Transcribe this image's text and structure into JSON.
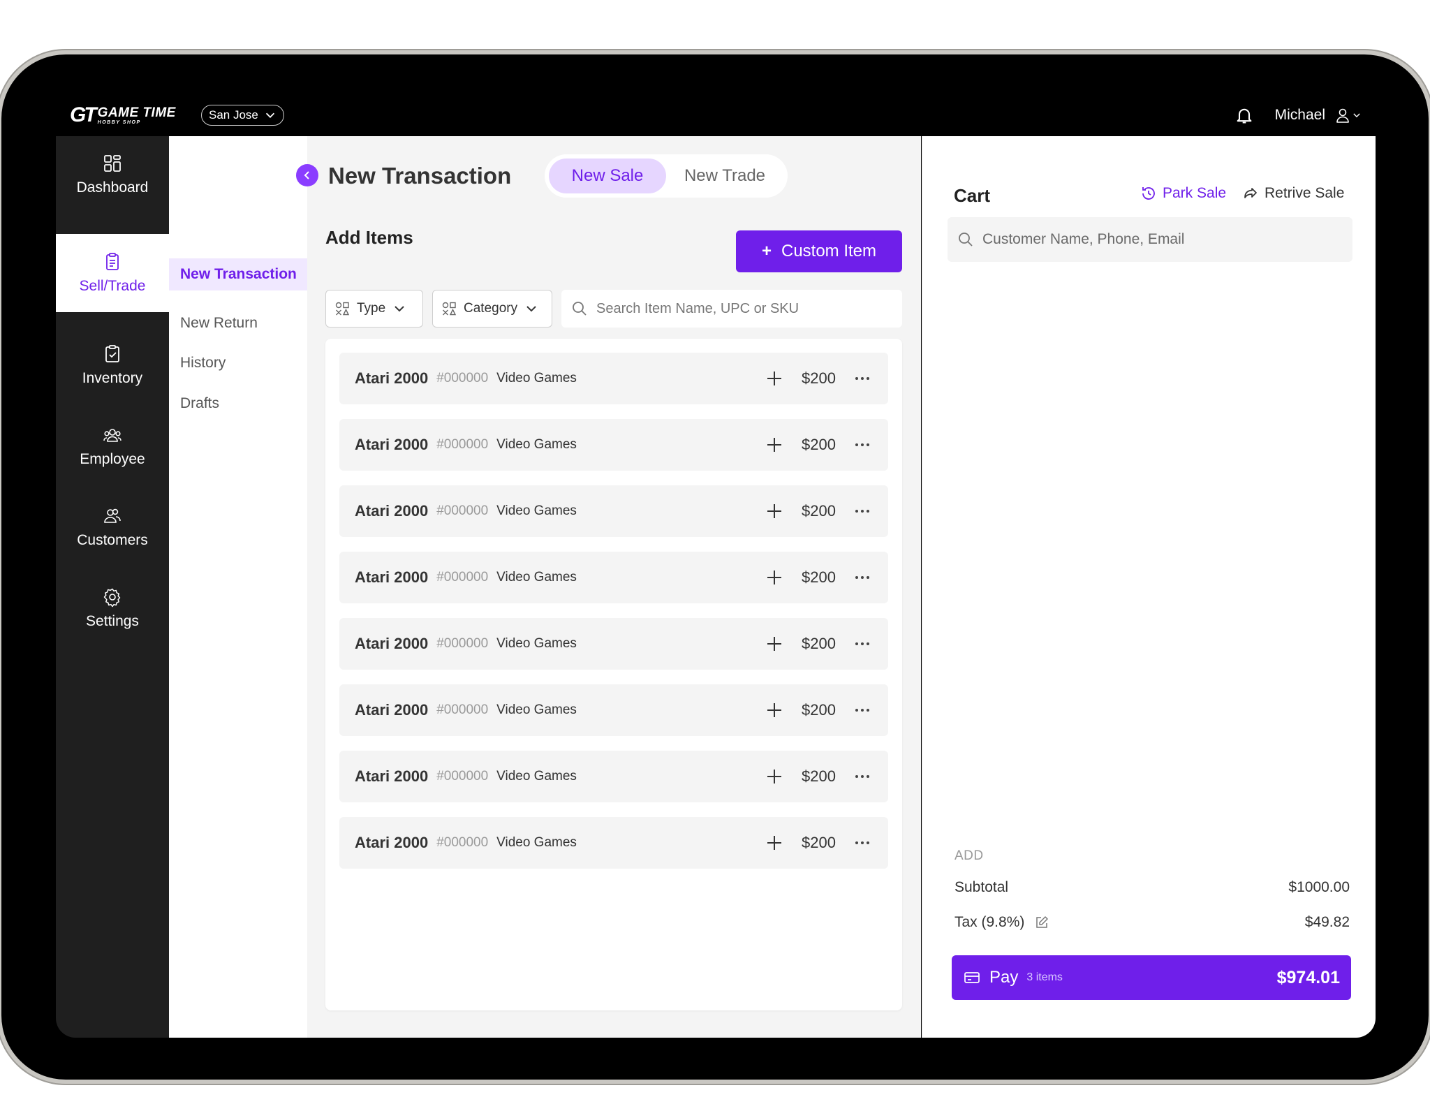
{
  "brand": {
    "mark": "GT",
    "name": "GAME TIME",
    "tagline": "HOBBY SHOP"
  },
  "location": {
    "selected": "San Jose"
  },
  "user": {
    "name": "Michael"
  },
  "nav": {
    "items": [
      {
        "label": "Dashboard",
        "icon": "grid-icon"
      },
      {
        "label": "Sell/Trade",
        "icon": "clipboard-icon",
        "active": true
      },
      {
        "label": "Inventory",
        "icon": "clipboard-check-icon"
      },
      {
        "label": "Employee",
        "icon": "group-icon"
      },
      {
        "label": "Customers",
        "icon": "users-icon"
      },
      {
        "label": "Settings",
        "icon": "gear-icon"
      }
    ]
  },
  "subnav": {
    "items": [
      {
        "label": "New Transaction",
        "active": true
      },
      {
        "label": "New Return"
      },
      {
        "label": "History"
      },
      {
        "label": "Drafts"
      }
    ]
  },
  "main": {
    "title": "New Transaction",
    "tabs": [
      {
        "label": "New Sale",
        "active": true
      },
      {
        "label": "New Trade"
      }
    ],
    "add_items_title": "Add Items",
    "custom_item_label": "Custom Item",
    "filters": {
      "type_label": "Type",
      "category_label": "Category"
    },
    "search_placeholder": "Search Item Name, UPC or SKU",
    "items": [
      {
        "name": "Atari 2000",
        "sku": "#000000",
        "category": "Video Games",
        "price": "$200"
      },
      {
        "name": "Atari 2000",
        "sku": "#000000",
        "category": "Video Games",
        "price": "$200"
      },
      {
        "name": "Atari 2000",
        "sku": "#000000",
        "category": "Video Games",
        "price": "$200"
      },
      {
        "name": "Atari 2000",
        "sku": "#000000",
        "category": "Video Games",
        "price": "$200"
      },
      {
        "name": "Atari 2000",
        "sku": "#000000",
        "category": "Video Games",
        "price": "$200"
      },
      {
        "name": "Atari 2000",
        "sku": "#000000",
        "category": "Video Games",
        "price": "$200"
      },
      {
        "name": "Atari 2000",
        "sku": "#000000",
        "category": "Video Games",
        "price": "$200"
      },
      {
        "name": "Atari 2000",
        "sku": "#000000",
        "category": "Video Games",
        "price": "$200"
      }
    ]
  },
  "cart": {
    "title": "Cart",
    "park_label": "Park Sale",
    "retrieve_label": "Retrive Sale",
    "customer_placeholder": "Customer Name, Phone, Email",
    "add_label": "ADD",
    "subtotal_label": "Subtotal",
    "subtotal_value": "$1000.00",
    "tax_label": "Tax (9.8%)",
    "tax_value": "$49.82",
    "pay_label": "Pay",
    "pay_count": "3 items",
    "pay_total": "$974.01"
  },
  "colors": {
    "accent": "#6f1fea",
    "accent_light": "#e6d6ff",
    "sidebar": "#1f1f1f"
  }
}
